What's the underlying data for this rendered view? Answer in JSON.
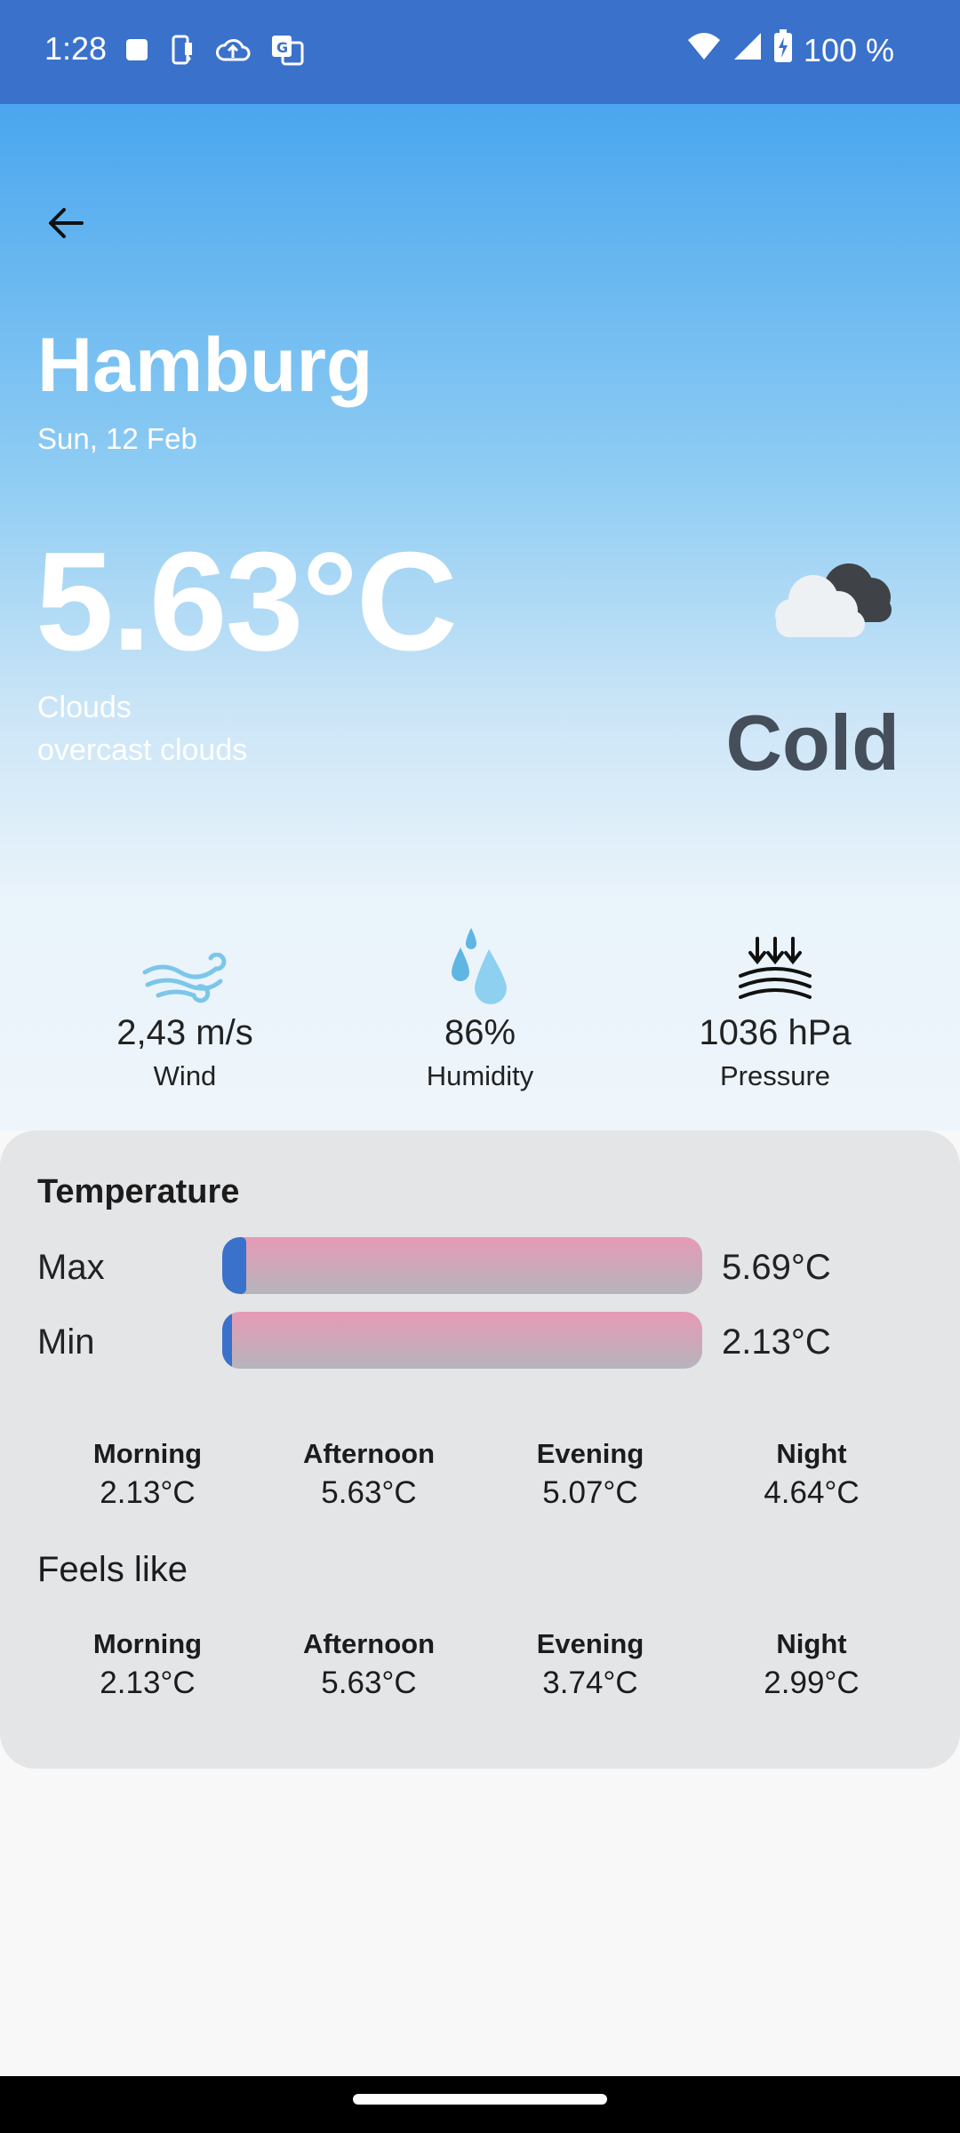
{
  "status_bar": {
    "time": "1:28",
    "battery": "100 %"
  },
  "header": {
    "city": "Hamburg",
    "date": "Sun, 12 Feb"
  },
  "current": {
    "temperature": "5.63°C",
    "condition": "Clouds",
    "description": "overcast clouds",
    "feel_word": "Cold",
    "icon": "cloud-icon"
  },
  "stats": [
    {
      "value": "2,43 m/s",
      "label": "Wind",
      "icon": "wind-icon"
    },
    {
      "value": "86%",
      "label": "Humidity",
      "icon": "humidity-icon"
    },
    {
      "value": "1036 hPa",
      "label": "Pressure",
      "icon": "pressure-icon"
    }
  ],
  "temperature_card": {
    "title": "Temperature",
    "max": {
      "label": "Max",
      "value": "5.69°C",
      "level_fraction": 0.05
    },
    "min": {
      "label": "Min",
      "value": "2.13°C",
      "level_fraction": 0.02
    },
    "periods": [
      {
        "label": "Morning",
        "value": "2.13°C"
      },
      {
        "label": "Afternoon",
        "value": "5.63°C"
      },
      {
        "label": "Evening",
        "value": "5.07°C"
      },
      {
        "label": "Night",
        "value": "4.64°C"
      }
    ],
    "feels_like_title": "Feels like",
    "feels_like": [
      {
        "label": "Morning",
        "value": "2.13°C"
      },
      {
        "label": "Afternoon",
        "value": "5.63°C"
      },
      {
        "label": "Evening",
        "value": "3.74°C"
      },
      {
        "label": "Night",
        "value": "2.99°C"
      }
    ]
  },
  "colors": {
    "accent": "#3a71cb",
    "feel_word": "#454f5c"
  }
}
